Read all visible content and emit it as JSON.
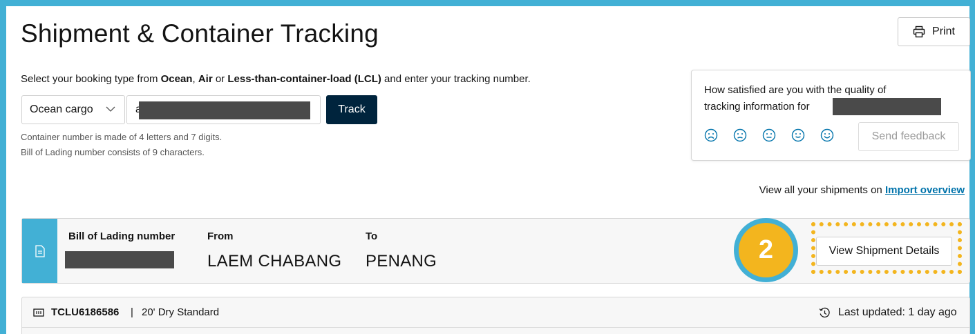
{
  "header": {
    "title": "Shipment & Container Tracking",
    "print_label": "Print"
  },
  "search": {
    "instruction_prefix": "Select your booking type from ",
    "type_ocean": "Ocean",
    "comma": ", ",
    "type_air": "Air",
    "or_word": " or ",
    "type_lcl": "Less-than-container-load (LCL)",
    "instruction_suffix": " and enter your tracking number.",
    "selected_type": "Ocean cargo",
    "input_value": "a",
    "track_label": "Track",
    "hint_container": "Container number is made of 4 letters and 7 digits.",
    "hint_bol": "Bill of Lading number consists of 9 characters."
  },
  "feedback": {
    "question_line1": "How satisfied are you with the quality of",
    "question_line2": "tracking information for",
    "ratings": [
      "very-dissatisfied-icon",
      "dissatisfied-icon",
      "neutral-icon",
      "satisfied-icon",
      "very-satisfied-icon"
    ],
    "send_label": "Send feedback"
  },
  "overview": {
    "prefix": "View all your shipments on ",
    "link": "Import overview"
  },
  "shipment": {
    "bol_label": "Bill of Lading number",
    "from_label": "From",
    "to_label": "To",
    "from_value": "LAEM CHABANG",
    "to_value": "PENANG",
    "details_label": "View Shipment Details",
    "step_badge": "2"
  },
  "container": {
    "id": "TCLU6186586",
    "separator": "|",
    "type": "20' Dry Standard",
    "last_updated": "Last updated: 1 day ago"
  },
  "colors": {
    "accent": "#42b0d5",
    "primary_button": "#00243d",
    "highlight": "#f3b51e",
    "link": "#0073ab"
  }
}
